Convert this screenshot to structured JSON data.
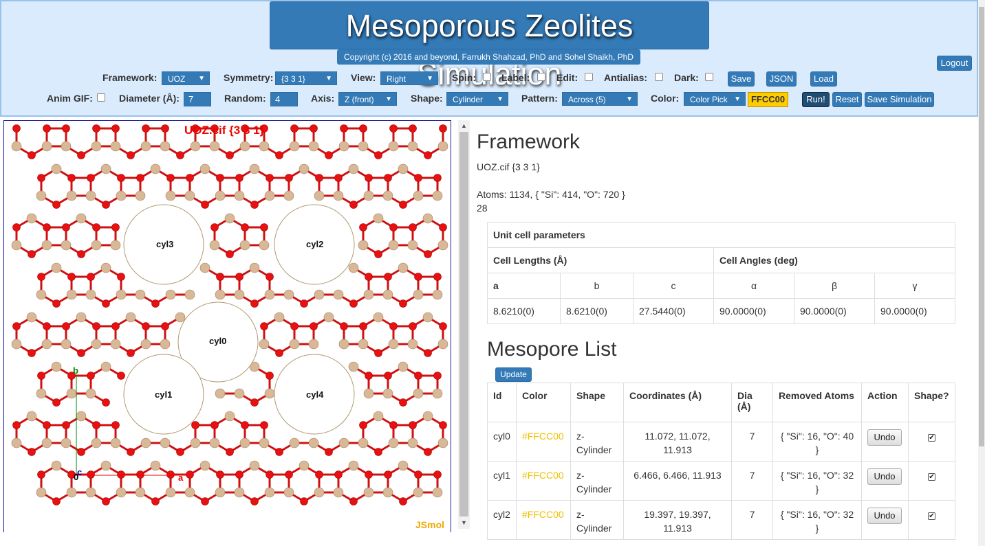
{
  "header": {
    "title": "Mesoporous Zeolites Simulation",
    "copyright": "Copyright (c) 2016 and beyond, Farrukh Shahzad, PhD and Sohel Shaikh, PhD",
    "logout": "Logout",
    "row1": {
      "framework_label": "Framework:",
      "framework_value": "UOZ",
      "symmetry_label": "Symmetry:",
      "symmetry_value": "{3 3 1}",
      "view_label": "View:",
      "view_value": "Right",
      "spin_label": "Spin:",
      "label_label": "Label:",
      "edit_label": "Edit:",
      "antialias_label": "Antialias:",
      "dark_label": "Dark:",
      "save": "Save",
      "json": "JSON",
      "load": "Load"
    },
    "row2": {
      "animgif_label": "Anim GIF:",
      "diameter_label": "Diameter (Å):",
      "diameter_value": "7",
      "random_label": "Random:",
      "random_value": "4",
      "axis_label": "Axis:",
      "axis_value": "Z (front)",
      "shape_label": "Shape:",
      "shape_value": "Cylinder",
      "pattern_label": "Pattern:",
      "pattern_value": "Across (5)",
      "color_label": "Color:",
      "color_picker": "Color Pick",
      "color_value": "FFCC00",
      "run": "Run!",
      "reset": "Reset",
      "save_sim": "Save Simulation"
    }
  },
  "viewer": {
    "title": "UOZ.cif {3 3 1}",
    "logo": "JSmol",
    "cylinders": [
      "cyl0",
      "cyl1",
      "cyl2",
      "cyl3",
      "cyl4"
    ],
    "axes": {
      "a": "a",
      "b": "b",
      "c": "c",
      "origin": "0"
    }
  },
  "framework": {
    "heading": "Framework",
    "file": "UOZ.cif {3 3 1}",
    "atoms": "Atoms: 1134, { \"Si\": 414, \"O\": 720 }",
    "extra": "28"
  },
  "unit_cell": {
    "title": "Unit cell parameters",
    "lengths_title": "Cell Lengths (Å)",
    "angles_title": "Cell Angles (deg)",
    "headers": [
      "a",
      "b",
      "c",
      "α",
      "β",
      "γ"
    ],
    "values": [
      "8.6210(0)",
      "8.6210(0)",
      "27.5440(0)",
      "90.0000(0)",
      "90.0000(0)",
      "90.0000(0)"
    ]
  },
  "mesopores": {
    "heading": "Mesopore List",
    "update": "Update",
    "columns": [
      "Id",
      "Color",
      "Shape",
      "Coordinates (Å)",
      "Dia (Å)",
      "Removed Atoms",
      "Action",
      "Shape?"
    ],
    "rows": [
      {
        "id": "cyl0",
        "color": "#FFCC00",
        "shape": "z-Cylinder",
        "coords": "11.072, 11.072, 11.913",
        "dia": "7",
        "removed": "{ \"Si\": 16, \"O\": 40 }",
        "action": "Undo",
        "checked": "✔"
      },
      {
        "id": "cyl1",
        "color": "#FFCC00",
        "shape": "z-Cylinder",
        "coords": "6.466, 6.466, 11.913",
        "dia": "7",
        "removed": "{ \"Si\": 16, \"O\": 32 }",
        "action": "Undo",
        "checked": "✔"
      },
      {
        "id": "cyl2",
        "color": "#FFCC00",
        "shape": "z-Cylinder",
        "coords": "19.397, 19.397, 11.913",
        "dia": "7",
        "removed": "{ \"Si\": 16, \"O\": 32 }",
        "action": "Undo",
        "checked": "✔"
      }
    ]
  }
}
